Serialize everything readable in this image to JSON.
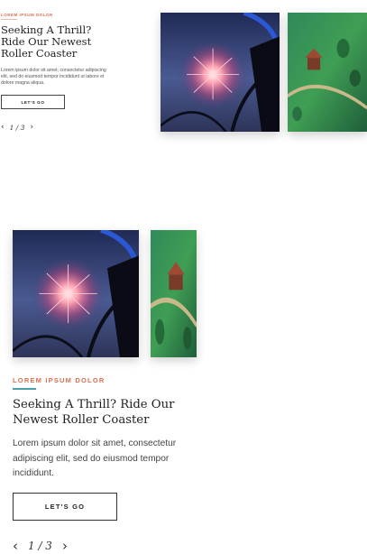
{
  "top": {
    "eyebrow": "LOREM IPSUM DOLOR",
    "heading": "Seeking A Thrill? Ride Our Newest Roller Coaster",
    "body": "Lorem ipsum dolor sit amet, consectetur adipiscing elit, sed do eiusmod tempor incididunt ut labore et dolore magna aliqua.",
    "button_label": "LET'S GO",
    "pager": "1 / 3",
    "images": [
      "fireworks-over-roller-coaster",
      "aerial-theme-park"
    ]
  },
  "mobile": {
    "eyebrow": "LOREM IPSUM DOLOR",
    "heading": "Seeking A Thrill? Ride Our Newest Roller Coaster",
    "body": "Lorem ipsum dolor sit amet, consectetur adipiscing elit, sed do eiusmod tempor incididunt.",
    "button_label": "LET'S GO",
    "pager": "1 / 3",
    "images": [
      "fireworks-over-roller-coaster",
      "aerial-theme-park"
    ]
  },
  "icons": {
    "prev": "chevron-left-icon",
    "next": "chevron-right-icon"
  },
  "colors": {
    "accent": "#d9704e",
    "teal_rule": "#4aa0a8",
    "text": "#1f1f1f"
  }
}
